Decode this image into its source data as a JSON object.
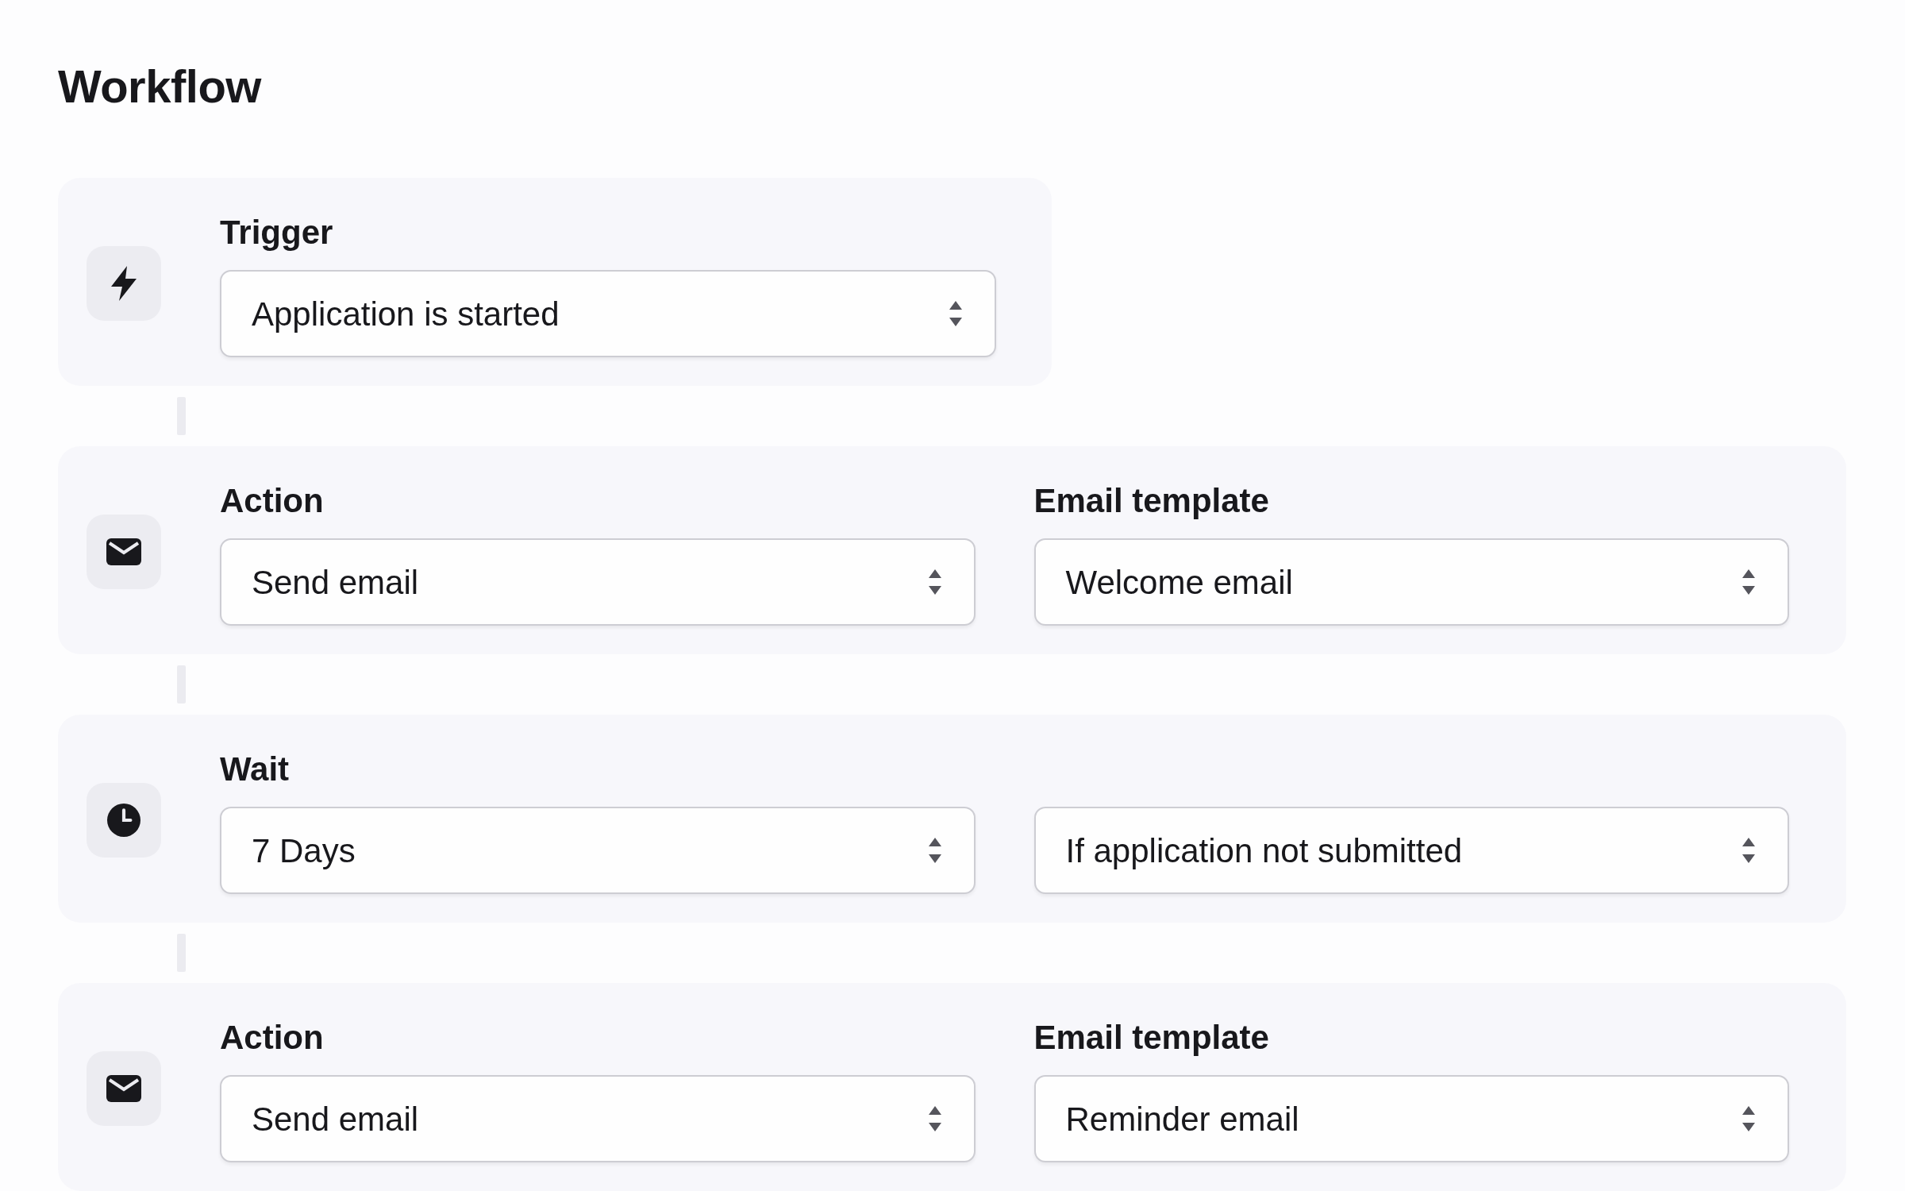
{
  "page": {
    "title": "Workflow"
  },
  "steps": [
    {
      "kind": "trigger",
      "fields": [
        {
          "label": "Trigger",
          "value": "Application is started"
        }
      ]
    },
    {
      "kind": "action",
      "fields": [
        {
          "label": "Action",
          "value": "Send email"
        },
        {
          "label": "Email template",
          "value": "Welcome email"
        }
      ]
    },
    {
      "kind": "wait",
      "fields": [
        {
          "label": "Wait",
          "value": "7 Days"
        },
        {
          "value": "If application not submitted"
        }
      ]
    },
    {
      "kind": "action",
      "fields": [
        {
          "label": "Action",
          "value": "Send email"
        },
        {
          "label": "Email template",
          "value": "Reminder email"
        }
      ]
    }
  ]
}
